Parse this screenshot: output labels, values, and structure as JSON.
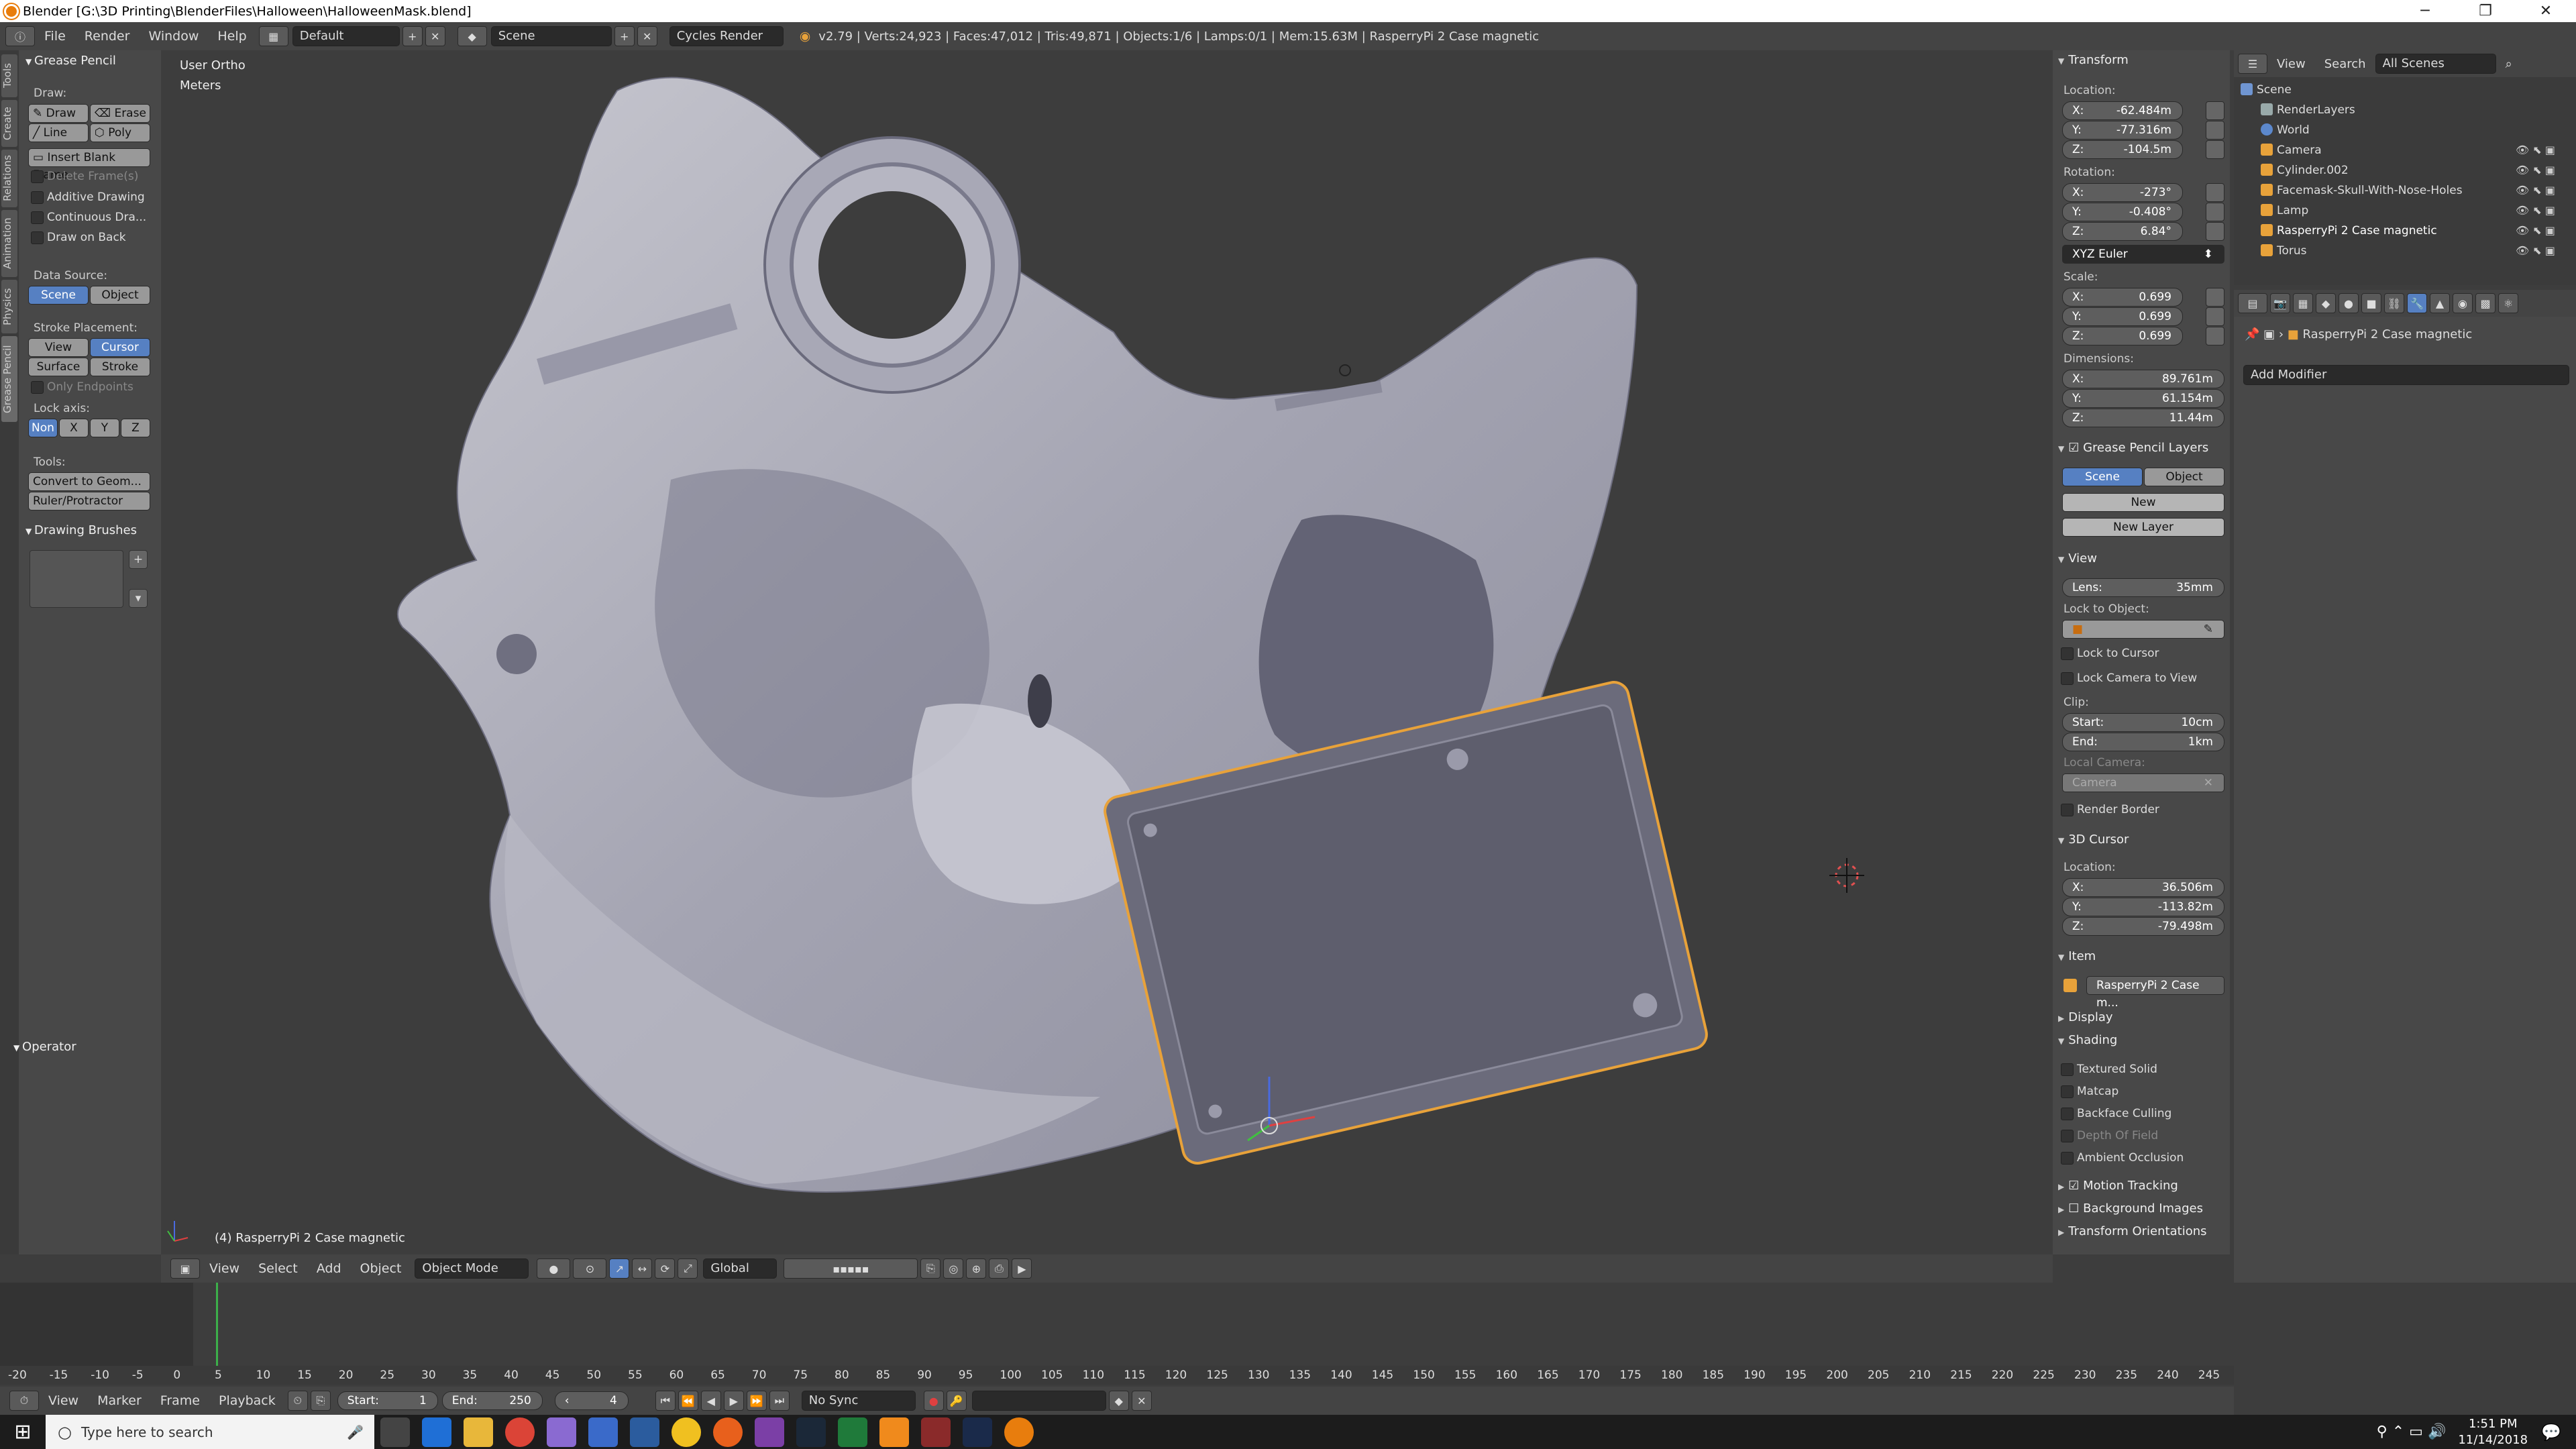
{
  "titlebar": {
    "title": "Blender [G:\\3D Printing\\BlenderFiles\\Halloween\\HalloweenMask.blend]",
    "minimize": "─",
    "maximize": "❐",
    "close": "✕"
  },
  "info": {
    "menus": [
      "File",
      "Render",
      "Window",
      "Help"
    ],
    "layout": "Default",
    "scene": "Scene",
    "engine": "Cycles Render",
    "stats": "v2.79 | Verts:24,923 | Faces:47,012 | Tris:49,871 | Objects:1/6 | Lamps:0/1 | Mem:15.63M | RasperryPi 2 Case magnetic"
  },
  "tabs": [
    "Tools",
    "Create",
    "Relations",
    "Animation",
    "Physics",
    "Grease Pencil"
  ],
  "toolshelf": {
    "panel_title": "Grease Pencil",
    "draw_label": "Draw:",
    "draw": "Draw",
    "erase": "Erase",
    "line": "Line",
    "poly": "Poly",
    "insert_blank": "Insert Blank Frame",
    "delete_frames": "Delete Frame(s)",
    "additive": "Additive Drawing",
    "continuous": "Continuous Dra...",
    "draw_on_back": "Draw on Back",
    "data_source_label": "Data Source:",
    "ds_scene": "Scene",
    "ds_object": "Object",
    "stroke_placement_label": "Stroke Placement:",
    "sp_view": "View",
    "sp_cursor": "Cursor",
    "sp_surface": "Surface",
    "sp_stroke": "Stroke",
    "only_endpoints": "Only Endpoints",
    "lock_axis_label": "Lock axis:",
    "lock_axes": [
      "Non",
      "X",
      "Y",
      "Z"
    ],
    "tools_label": "Tools:",
    "convert": "Convert to Geom...",
    "ruler": "Ruler/Protractor",
    "brushes_title": "Drawing Brushes",
    "operator_title": "Operator"
  },
  "viewport": {
    "view_name": "User Ortho",
    "units": "Meters",
    "object_label": "(4) RasperryPi 2 Case magnetic"
  },
  "vp_header": {
    "menus": [
      "View",
      "Select",
      "Add",
      "Object"
    ],
    "mode": "Object Mode",
    "orientation": "Global"
  },
  "npanel": {
    "transform_title": "Transform",
    "location_label": "Location:",
    "loc": {
      "x": "-62.484m",
      "y": "-77.316m",
      "z": "-104.5m"
    },
    "rotation_label": "Rotation:",
    "rot": {
      "x": "-273°",
      "y": "-0.408°",
      "z": "6.84°"
    },
    "rot_mode": "XYZ Euler",
    "scale_label": "Scale:",
    "scale": {
      "x": "0.699",
      "y": "0.699",
      "z": "0.699"
    },
    "dimensions_label": "Dimensions:",
    "dim": {
      "x": "89.761m",
      "y": "61.154m",
      "z": "11.44m"
    },
    "gp_layers_title": "Grease Pencil Layers",
    "gp_scene": "Scene",
    "gp_object": "Object",
    "gp_new": "New",
    "gp_new_layer": "New Layer",
    "view_title": "View",
    "lens_label": "Lens:",
    "lens_value": "35mm",
    "lock_to_object_label": "Lock to Object:",
    "lock_to_cursor": "Lock to Cursor",
    "lock_camera": "Lock Camera to View",
    "clip_label": "Clip:",
    "clip_start_label": "Start:",
    "clip_start": "10cm",
    "clip_end_label": "End:",
    "clip_end": "1km",
    "local_camera_label": "Local Camera:",
    "local_camera": "Camera",
    "render_border": "Render Border",
    "cursor_title": "3D Cursor",
    "cursor_loc_label": "Location:",
    "cursor": {
      "x": "36.506m",
      "y": "-113.82m",
      "z": "-79.498m"
    },
    "item_title": "Item",
    "item_name": "RasperryPi 2 Case m...",
    "display_title": "Display",
    "shading_title": "Shading",
    "textured_solid": "Textured Solid",
    "matcap": "Matcap",
    "backface": "Backface Culling",
    "dof": "Depth Of Field",
    "ao": "Ambient Occlusion",
    "motion_tracking": "Motion Tracking",
    "background_images": "Background Images",
    "transform_orientations": "Transform Orientations"
  },
  "outliner": {
    "menus": [
      "View",
      "Search"
    ],
    "filter": "All Scenes",
    "items": [
      {
        "label": "Scene",
        "icon": "scene-icon",
        "depth": 0
      },
      {
        "label": "RenderLayers",
        "icon": "renderlayers-icon",
        "depth": 1
      },
      {
        "label": "World",
        "icon": "world-icon",
        "depth": 1
      },
      {
        "label": "Camera",
        "icon": "camera-icon",
        "depth": 1
      },
      {
        "label": "Cylinder.002",
        "icon": "mesh-icon",
        "depth": 1
      },
      {
        "label": "Facemask-Skull-With-Nose-Holes",
        "icon": "mesh-icon",
        "depth": 1
      },
      {
        "label": "Lamp",
        "icon": "lamp-icon",
        "depth": 1
      },
      {
        "label": "RasperryPi 2 Case magnetic",
        "icon": "mesh-icon",
        "depth": 1
      },
      {
        "label": "Torus",
        "icon": "mesh-icon",
        "depth": 1
      }
    ]
  },
  "props": {
    "object_name": "RasperryPi 2 Case magnetic",
    "add_modifier": "Add Modifier"
  },
  "timeline": {
    "ticks": [
      "-20",
      "-15",
      "-10",
      "-5",
      "0",
      "5",
      "10",
      "15",
      "20",
      "25",
      "30",
      "35",
      "40",
      "45",
      "50",
      "55",
      "60",
      "65",
      "70",
      "75",
      "80",
      "85",
      "90",
      "95",
      "100",
      "105",
      "110",
      "115",
      "120",
      "125",
      "130",
      "135",
      "140",
      "145",
      "150",
      "155",
      "160",
      "165",
      "170",
      "175",
      "180",
      "185",
      "190",
      "195",
      "200",
      "205",
      "210",
      "215",
      "220",
      "225",
      "230",
      "235",
      "240",
      "245"
    ],
    "menus": [
      "View",
      "Marker",
      "Frame",
      "Playback"
    ],
    "start_label": "Start:",
    "start": "1",
    "end_label": "End:",
    "end": "250",
    "current": "4",
    "sync": "No Sync"
  },
  "taskbar": {
    "search": "Type here to search",
    "time": "1:51 PM",
    "date": "11/14/2018"
  }
}
